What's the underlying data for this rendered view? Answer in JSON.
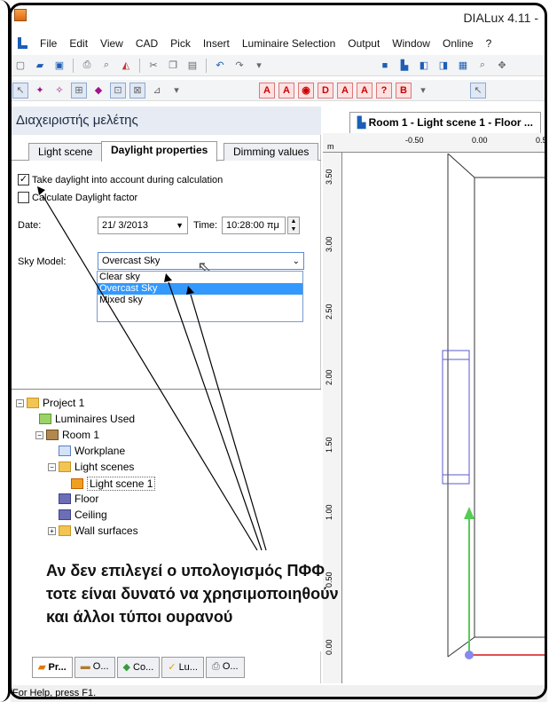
{
  "window": {
    "title": "DIALux 4.11 -"
  },
  "menu": [
    "File",
    "Edit",
    "View",
    "CAD",
    "Pick",
    "Insert",
    "Luminaire Selection",
    "Output",
    "Window",
    "Online",
    "?"
  ],
  "panel": {
    "title": "Διαχειριστής μελέτης",
    "tabs": [
      "Light scene",
      "Daylight properties",
      "Dimming values"
    ],
    "daylight": {
      "take_daylight_label": "Take daylight into account during calculation",
      "take_daylight_checked": true,
      "calc_factor_label": "Calculate Daylight factor",
      "calc_factor_checked": false,
      "date_label": "Date:",
      "date_value": "21/ 3/2013",
      "time_label": "Time:",
      "time_value": "10:28:00 πμ",
      "sky_model_label": "Sky Model:",
      "sky_model_value": "Overcast Sky",
      "sky_options": [
        "Clear sky",
        "Overcast Sky",
        "Mixed sky"
      ],
      "sky_selected": "Overcast Sky"
    }
  },
  "tree": {
    "project": "Project 1",
    "luminaires_used": "Luminaires Used",
    "room": "Room 1",
    "workplane": "Workplane",
    "light_scenes": "Light scenes",
    "light_scene_1": "Light scene 1",
    "floor": "Floor",
    "ceiling": "Ceiling",
    "wall_surfaces": "Wall surfaces"
  },
  "bottom_tabs": [
    "Pr...",
    "O...",
    "Co...",
    "Lu...",
    "O..."
  ],
  "cad": {
    "tab_label": "Room 1 - Light scene 1 - Floor ...",
    "ruler_unit": "m",
    "top_ticks": [
      "-0.50",
      "0.00",
      "0.5"
    ],
    "left_ticks": [
      "3.50",
      "3.00",
      "2.50",
      "2.00",
      "1.50",
      "1.00",
      "0.50",
      "0.00"
    ]
  },
  "annotation": {
    "line1": "Αν δεν επιλεγεί ο υπολογισμός ΠΦΦ",
    "line2": "τοτε είναι δυνατό να χρησιμοποιηθούν",
    "line3": "και άλλοι τύποι ουρανού"
  },
  "status": {
    "text": "For Help, press F1."
  },
  "colors": {
    "selection": "#3399ff",
    "panel_header": "#e7ebf3",
    "axis_green": "#55cc55",
    "axis_red": "#e05050",
    "axis_point": "#8888ee"
  }
}
